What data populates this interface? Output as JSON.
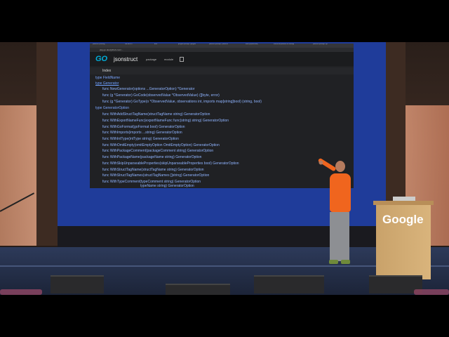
{
  "browser": {
    "tabs": [
      "jsonstruct (GoLang)",
      "GoLab2023",
      "ADB",
      "go/types package - go/types",
      "jsonstruct package - jsonstruct",
      "Bard (Experimental)",
      "Build an AI-powered Go Webapp",
      "jsonstruct package - go"
    ],
    "url": "pkg.go.dev/github.com/..."
  },
  "header": {
    "logo": "GO",
    "package_name": "jsonstruct",
    "nav": [
      "package",
      "module"
    ]
  },
  "index_label": "Index",
  "code_lines": [
    "type FieldName",
    "type Generator",
    "func NewGenerator(options ...GeneratorOption) *Generator",
    "func (g *Generator) GoCode(observedValue *ObservedValue) ([]byte, error)",
    "func (g *Generator) GoType(o *ObservedValue, observations int, imports map[string]bool) (string, bool)",
    "type GeneratorOption",
    "func WithAddStructTagName(structTagName string) GeneratorOption",
    "func WithExportNameFunc(exportNameFunc func(string) string) GeneratorOption",
    "func WithGoFormat(goFormat bool) GeneratorOption",
    "func WithImports(imports ...string) GeneratorOption",
    "func WithIntType(intType string) GeneratorOption",
    "func WithOmitEmpty(omitEmptyOption OmitEmptyOption) GeneratorOption",
    "func WithPackageComment(packageComment string) GeneratorOption",
    "func WithPackageName(packageName string) GeneratorOption",
    "func WithSkipUnparseableProperties(skipUnparseableProperties bool) GeneratorOption",
    "func WithStructTagName(structTagName string) GeneratorOption",
    "func WithStructTagNames(structTagNames []string) GeneratorOption",
    "func WithTypeComment(typeComment string) GeneratorOption",
    "typeName string) GeneratorOption"
  ],
  "podium": {
    "logo": "Google"
  },
  "colors": {
    "go_blue": "#00add8",
    "shirt": "#f0651e",
    "screen_frame": "#1f3c9a"
  }
}
